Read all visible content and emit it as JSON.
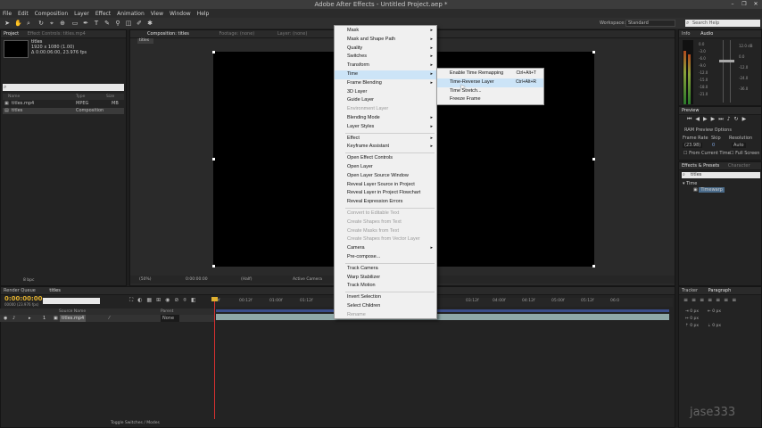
{
  "app": {
    "title": "Adobe After Effects - Untitled Project.aep *",
    "window_controls": [
      "–",
      "❐",
      "✕"
    ]
  },
  "menubar": [
    "File",
    "Edit",
    "Composition",
    "Layer",
    "Effect",
    "Animation",
    "View",
    "Window",
    "Help"
  ],
  "toolbar": {
    "workspace_label": "Workspace:",
    "workspace_value": "Standard",
    "search_placeholder": "Search Help"
  },
  "project_panel": {
    "tab": "Project",
    "tab2": "Effect Controls: titles.mp4",
    "item_name": "titles",
    "item_dims": "1920 x 1080 (1.00)",
    "item_duration": "Δ 0:00:06:00, 23.976 fps",
    "columns": [
      "Name",
      "Type",
      "Size"
    ],
    "rows": [
      {
        "name": "titles.mp4",
        "type": "MPEG",
        "size": "MB"
      },
      {
        "name": "titles",
        "type": "Composition",
        "size": ""
      }
    ],
    "bpc": "8 bpc"
  },
  "comp_panel": {
    "tab": "Composition: titles",
    "tab_footage": "Footage: (none)",
    "tab_layer": "Layer: (none)",
    "breadcrumb": "titles",
    "zoom": "(50%)",
    "timecode": "0:00:00:00",
    "resolution": "(Half)",
    "camera": "Active Camera",
    "views": "1 View"
  },
  "context_menu": {
    "items": [
      {
        "label": "Mask",
        "submenu": true
      },
      {
        "label": "Mask and Shape Path",
        "submenu": true
      },
      {
        "label": "Quality",
        "submenu": true
      },
      {
        "label": "Switches",
        "submenu": true
      },
      {
        "label": "Transform",
        "submenu": true
      },
      {
        "label": "Time",
        "submenu": true,
        "highlight": true
      },
      {
        "label": "Frame Blending",
        "submenu": true
      },
      {
        "label": "3D Layer"
      },
      {
        "label": "Guide Layer"
      },
      {
        "label": "Environment Layer",
        "disabled": true
      },
      {
        "label": "Blending Mode",
        "submenu": true
      },
      {
        "label": "Layer Styles",
        "submenu": true
      },
      {
        "label": "Effect",
        "submenu": true,
        "sep_before": true
      },
      {
        "label": "Keyframe Assistant",
        "submenu": true
      },
      {
        "label": "Open Effect Controls",
        "sep_before": true
      },
      {
        "label": "Open Layer"
      },
      {
        "label": "Open Layer Source Window"
      },
      {
        "label": "Reveal Layer Source in Project"
      },
      {
        "label": "Reveal Layer in Project Flowchart"
      },
      {
        "label": "Reveal Expression Errors"
      },
      {
        "label": "Convert to Editable Text",
        "disabled": true,
        "sep_before": true
      },
      {
        "label": "Create Shapes from Text",
        "disabled": true
      },
      {
        "label": "Create Masks from Text",
        "disabled": true
      },
      {
        "label": "Create Shapes from Vector Layer",
        "disabled": true
      },
      {
        "label": "Camera",
        "submenu": true
      },
      {
        "label": "Pre-compose..."
      },
      {
        "label": "Track Camera",
        "sep_before": true
      },
      {
        "label": "Warp Stabilizer"
      },
      {
        "label": "Track Motion"
      },
      {
        "label": "Invert Selection",
        "sep_before": true
      },
      {
        "label": "Select Children"
      },
      {
        "label": "Rename",
        "disabled": true
      }
    ]
  },
  "submenu": {
    "items": [
      {
        "label": "Enable Time Remapping",
        "shortcut": "Ctrl+Alt+T"
      },
      {
        "label": "Time-Reverse Layer",
        "shortcut": "Ctrl+Alt+R",
        "highlight": true
      },
      {
        "label": "Time Stretch...",
        "shortcut": ""
      },
      {
        "label": "Freeze Frame",
        "shortcut": ""
      }
    ]
  },
  "timeline": {
    "tab_render": "Render Queue",
    "tab_comp": "titles",
    "timecode": "0:00:00:00",
    "fps_info": "00000 (23.976 fps)",
    "col_source": "Source Name",
    "col_parent": "Parent",
    "layer_index": "1",
    "layer_name": "titles.mp4",
    "layer_parent": "None",
    "ruler_labels": [
      "0f",
      "00:12f",
      "01:00f",
      "01:12f",
      "02:00f",
      "02:12f",
      "03:00f",
      "03:12f",
      "04:00f",
      "04:12f",
      "05:00f",
      "05:12f",
      "06:0"
    ],
    "toggle_label": "Toggle Switches / Modes"
  },
  "right_panels": {
    "info_tab": "Info",
    "audio_tab": "Audio",
    "audio_db_left": [
      "0.0",
      "-3.0",
      "-6.0",
      "-9.0",
      "-12.0",
      "-15.0",
      "-18.0",
      "-21.0",
      "-24.0"
    ],
    "audio_db_right": [
      "12.0 dB",
      "0.0",
      "-12.0",
      "-24.0",
      "-36.0",
      "-48.0"
    ],
    "preview_tab": "Preview",
    "ram_preview": "RAM Preview Options",
    "frame_rate": "Frame Rate",
    "skip": "Skip",
    "resolution": "Resolution",
    "fr_value": "(23.98)",
    "skip_value": "0",
    "res_value": "Auto",
    "from_current": "From Current Time",
    "full_screen": "Full Screen",
    "effects_tab": "Effects & Presets",
    "character_tab": "Character",
    "effects_search": "titles",
    "effects_group": "▾ Time",
    "effects_item": "Timewarp",
    "tracker_tab": "Tracker",
    "paragraph_tab": "Paragraph",
    "para_values": [
      "0 px",
      "0 px",
      "0 px",
      "0 px",
      "0 px"
    ]
  },
  "watermark": "jase333"
}
